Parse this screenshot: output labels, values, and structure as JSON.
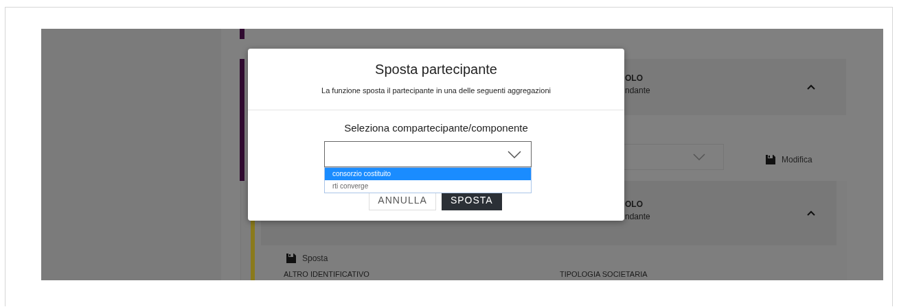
{
  "background": {
    "cards": [
      {
        "title": "OLO",
        "subtitle": "ndante",
        "expanded": true
      },
      {
        "title": "OLO",
        "subtitle": "ndante",
        "expanded": true
      }
    ],
    "edit_button": "Modifica",
    "move_button": "Sposta",
    "columns": [
      "ALTRO IDENTIFICATIVO",
      "TIPOLOGIA SOCIETARIA"
    ]
  },
  "dialog": {
    "title": "Sposta partecipante",
    "subtitle": "La funzione sposta il partecipante in una delle seguenti aggregazioni",
    "label": "Seleziona compartecipante/componente",
    "select": {
      "open": true,
      "options": [
        {
          "label": "consorzio costituito",
          "selected": true
        },
        {
          "label": "rti converge",
          "selected": false
        }
      ]
    },
    "buttons": [
      {
        "label": "ANNULLA",
        "kind": "secondary"
      },
      {
        "label": "SPOSTA",
        "kind": "primary"
      }
    ]
  }
}
